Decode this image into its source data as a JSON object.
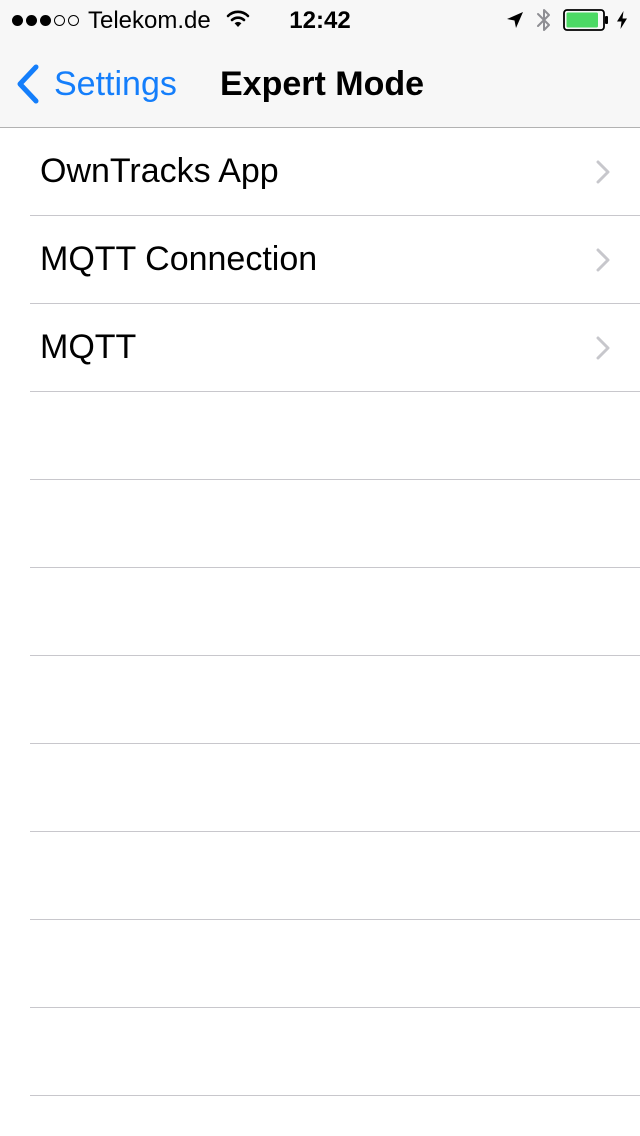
{
  "status_bar": {
    "signal_filled": 3,
    "signal_total": 5,
    "carrier": "Telekom.de",
    "time": "12:42",
    "battery_level": 0.9,
    "battery_color": "#4cd964",
    "icons": [
      "wifi-icon",
      "location-arrow-icon",
      "bluetooth-icon",
      "battery-icon",
      "charging-bolt-icon"
    ]
  },
  "nav_bar": {
    "back_label": "Settings",
    "title": "Expert Mode",
    "accent_color": "#147efb"
  },
  "table": {
    "rows": [
      {
        "label": "OwnTracks App"
      },
      {
        "label": "MQTT Connection"
      },
      {
        "label": "MQTT"
      }
    ],
    "empty_row_count": 8,
    "separator_color": "#c8c7cc"
  }
}
